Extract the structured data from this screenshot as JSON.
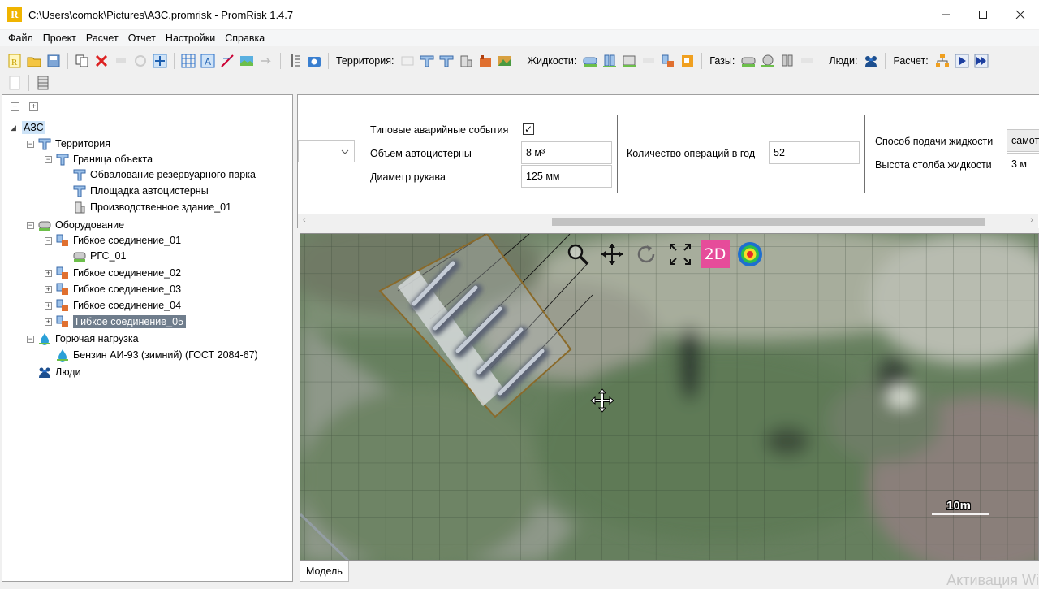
{
  "window": {
    "title": "C:\\Users\\comok\\Pictures\\АЗС.promrisk - PromRisk 1.4.7",
    "logo_letter": "R",
    "controls": [
      "minimize-icon",
      "maximize-icon",
      "close-icon"
    ]
  },
  "menu": [
    "Файл",
    "Проект",
    "Расчет",
    "Отчет",
    "Настройки",
    "Справка"
  ],
  "toolbar": {
    "territory_label": "Территория:",
    "liquids_label": "Жидкости:",
    "gases_label": "Газы:",
    "people_label": "Люди:",
    "calc_label": "Расчет:"
  },
  "tree": {
    "nodes": [
      {
        "label": "АЗС",
        "icon": "none",
        "state": "expanded-caret",
        "selected": "light"
      },
      {
        "label": "Территория",
        "icon": "territory-icon",
        "state": "minus"
      },
      {
        "label": "Граница объекта",
        "icon": "territory-icon",
        "state": "minus"
      },
      {
        "label": "Обвалование резервуарного парка",
        "icon": "territory-icon",
        "state": "none"
      },
      {
        "label": "Площадка автоцистерны",
        "icon": "territory-icon",
        "state": "none"
      },
      {
        "label": "Производственное здание_01",
        "icon": "building-icon",
        "state": "none"
      },
      {
        "label": "Оборудование",
        "icon": "equipment-icon",
        "state": "minus"
      },
      {
        "label": "Гибкое соединение_01",
        "icon": "hose-icon",
        "state": "minus"
      },
      {
        "label": "РГС_01",
        "icon": "tank-icon",
        "state": "none"
      },
      {
        "label": "Гибкое соединение_02",
        "icon": "hose-icon",
        "state": "plus"
      },
      {
        "label": "Гибкое соединение_03",
        "icon": "hose-icon",
        "state": "plus"
      },
      {
        "label": "Гибкое соединение_04",
        "icon": "hose-icon",
        "state": "plus"
      },
      {
        "label": "Гибкое соединение_05",
        "icon": "hose-icon",
        "state": "plus",
        "selected": "dark"
      },
      {
        "label": "Горючая нагрузка",
        "icon": "fuel-icon",
        "state": "minus"
      },
      {
        "label": "Бензин АИ-93 (зимний) (ГОСТ 2084-67)",
        "icon": "fuel-icon",
        "state": "none"
      },
      {
        "label": "Люди",
        "icon": "people-icon",
        "state": "none"
      }
    ]
  },
  "props": {
    "typical_events_label": "Типовые аварийные события",
    "typical_events_checked": "✓",
    "tank_volume_label": "Объем автоцистерны",
    "tank_volume_value": "8 м³",
    "hose_diameter_label": "Диаметр рукава",
    "hose_diameter_value": "125 мм",
    "ops_per_year_label": "Количество операций в год",
    "ops_per_year_value": "52",
    "feed_method_label": "Способ подачи жидкости",
    "feed_method_value": "самот",
    "column_height_label": "Высота столба жидкости",
    "column_height_value": "3 м"
  },
  "map": {
    "mode_2d_label": "2D",
    "scale_label": "10m"
  },
  "bottom": {
    "tab_model": "Модель",
    "watermark": "Активация Wi"
  }
}
